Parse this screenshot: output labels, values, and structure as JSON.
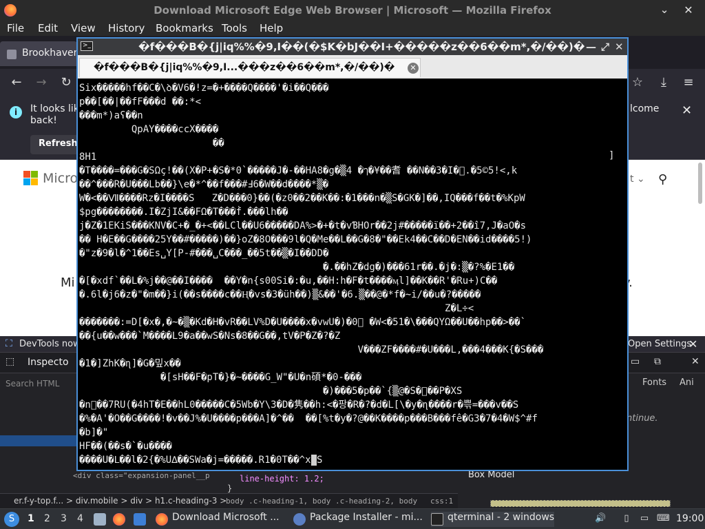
{
  "firefox": {
    "title": "Download Microsoft Edge Web Browser | Microsoft — Mozilla Firefox",
    "menu": [
      "File",
      "Edit",
      "View",
      "History",
      "Bookmarks",
      "Tools",
      "Help"
    ],
    "tab_label": "Brookhaven",
    "notice_text": "It looks lik back!",
    "notice_text_right": "lcome",
    "refresh_label": "Refresh",
    "page": {
      "brand": "Micro",
      "heading_left": "Mi",
      "heading_right": "y."
    },
    "devtools": {
      "notice": "DevTools now f",
      "open_settings": "Open Settings",
      "inspector": "Inspecto",
      "search_placeholder": "Search HTML",
      "fonts_tab": "Fonts",
      "ani_tab": "Ani",
      "continue": "ntinue.",
      "div_line": "<div class=\"expansion-panel__p",
      "line_height": "line-height: 1.2;",
      "brace": "}",
      "box_model": "Box Model",
      "crumbs": "er.f-y-top.f...  >  div.mobile  >  div  >  h1.c-heading-3  >",
      "rule_crumb": "body .c-heading-1, body .c-heading-2, body",
      "css_label": "css:1"
    }
  },
  "terminal": {
    "title": "�f���B�{j|iq%%�9,I��(�$K�bJ��I+�����z��6��m*,�/��)�",
    "tab_label": "�f���B�{j|iq%%�9,I...���z��6��m*,�/��)�",
    "lines": [
      "Six�����hf��C�\\ꝺ�V6�!z=�+����Q����'�i��Q���",
      "p��[��|��fF���d ��:*<",
      "���m*)aʕ��n",
      "         QpAY����ccX����",
      "                       ��",
      "8H1",
      "�T����=���G�SΩç!��(X�P+�S�*0`�����J�-��HA8�g�▒4 �ๅ�¥��耆 ��N��3�I�⃞.�5©5!<,k",
      "��^���R�U���Lb��}\\e�*^��f���#Ⅎ6�W��d����*▒�",
      "W�<��Ⅶ����Rz�I����S   Z�D���0}��(�z0��2��K��:�1���n�▒S�GK�]��,IQ���f��t�%KpW",
      "$pg��������.I�ZjI&��FΩ�T���ḟ.���lh��",
      "j�Z�1EKiS���KNV�C+�_�+<��LCl��U6�����DA%>�+�t�vƁHOr��2j#�����ï��+2��î7,J�aO�s",
      "�� H�E��G����25Y��#�����)��}oZ�8O���9l�Q�Me��L��G�8�\"��Ek4��C��D�EN��id����5!)",
      "�\"z�9�l�^1��Es␣Y[P-#���␣C���_��5t��▒�I��DD�",
      "                                          �.��hZ�dg�)���61r��.�j�:▒�?%�E1��",
      "�[�xdf`��L�%j��@��I����  ��Y�n{s00Si�:�u,��H:h�F�t����ӎl]��K��R'�Ru+)C��",
      "�.6l�j6�z�\"�m��}i(��s����c��Ⱨ�vs�3�üh��)▒&��'�6.▒��@�*f�~i/��u�?�����",
      "                                                               Z�L÷<",
      "�������:=D[�x�,�~�▒�Kd�H�vR��LV%D�U����x�vwU�)�0⃞ �W<�51�\\���QYΩ��U��hp��>��`",
      "��{u��w���`M����L9�a��wS�Ns�8��G��,tV�P�Z�?�Z",
      "                                                V���ZF����#�U���L,���4���K{�S���",
      "�1�]ZhK�ɳ]�G�밒x��",
      "              �[sH��F�pT�}�~����G_W\"�U�n碩*�0-���",
      "                                          �)���5�p��`{▒@�S�⃞��P�XS",
      "�n⃞��7RU(�4hT�E��hL0�����C�5Wb�Y\\3�D�隽��h:<�팡�R�?�d�L[\\�y�ɳ����r�쁚=���v��S",
      "�%�A'�O��G����!�v��J%�U����p���A]�^��  ��[%t�y�?@��K����p���B���fê�G3�7�4�W$^#f",
      "�b]�\"",
      "HF��(��s�`�u����",
      "����U�Ⅼ��l�2{�%U∆��SWa�j=�����.R1�0T��^x"
    ],
    "last_line_tail": "S",
    "right_bracket": "]"
  },
  "taskbar": {
    "workspaces": [
      "1",
      "2",
      "3",
      "4"
    ],
    "tasks": [
      {
        "label": "Download Microsoft ..."
      },
      {
        "label": "Package Installer - mi..."
      },
      {
        "label": "qterminal - 2 windows"
      }
    ],
    "clock": "19:00"
  },
  "colors": {
    "terminal_bg": "#000000",
    "terminal_border": "#4a90d9",
    "taskbar_bg": "#2e3136"
  }
}
